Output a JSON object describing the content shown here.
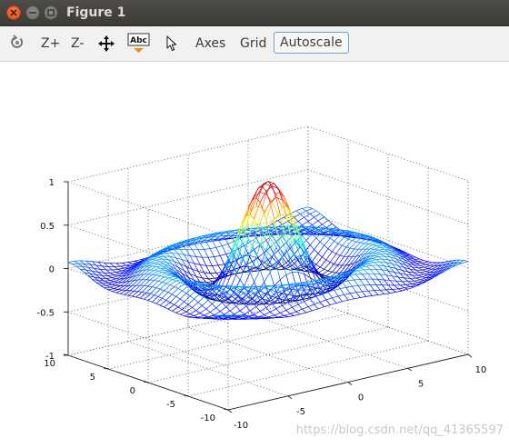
{
  "window": {
    "title": "Figure 1"
  },
  "toolbar": {
    "zoom_in_label": "Z+",
    "zoom_out_label": "Z-",
    "axes_label": "Axes",
    "grid_label": "Grid",
    "autoscale_label": "Autoscale"
  },
  "watermark": "https://blog.csdn.net/qq_41365597",
  "chart_data": {
    "type": "surface",
    "function": "sinc mesh: z = sin(r)/r, r = sqrt(x^2 + y^2)",
    "x_range": [
      -10,
      10
    ],
    "y_range": [
      -10,
      10
    ],
    "zlim": [
      -1,
      1
    ],
    "xticks": [
      "-10",
      "-5",
      "0",
      "5",
      "10"
    ],
    "yticks": [
      "10",
      "5",
      "0",
      "-5",
      "-10"
    ],
    "zticks": [
      "1",
      "0.5",
      "0",
      "-0.5",
      "-1"
    ],
    "grid": true,
    "colormap": "jet"
  }
}
